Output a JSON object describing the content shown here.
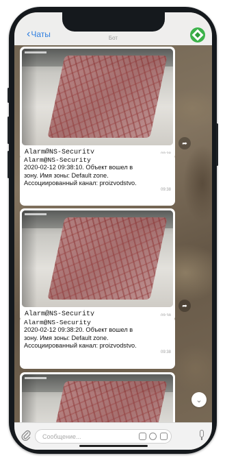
{
  "header": {
    "back_label": "Чаты",
    "chat_title": "Бот"
  },
  "messages": [
    {
      "type": "photo",
      "caption": "Alarm@NS-Security",
      "time": "09:38"
    },
    {
      "type": "text",
      "sender": "Alarm@NS-Security",
      "line1": "2020-02-12 09:38:10. Объект вошел в",
      "line2": "зону. Имя зоны: Default zone.",
      "line3": "Ассоциированный канал: proizvodstvo.",
      "time": "09:38"
    },
    {
      "type": "photo",
      "caption": "Alarm@NS-Security",
      "time": "09:38"
    },
    {
      "type": "text",
      "sender": "Alarm@NS-Security",
      "line1": "2020-02-12 09:38:20. Объект вошел в",
      "line2": "зону. Имя зоны: Default zone.",
      "line3": "Ассоциированный канал: proizvodstvo.",
      "time": "09:38"
    }
  ],
  "composer": {
    "placeholder": "Сообщение..."
  },
  "icons": {
    "back": "chevron-left-icon",
    "avatar": "bot-avatar-icon",
    "share": "share-arrow-icon",
    "scroll": "chevron-down-icon",
    "attach": "paperclip-icon",
    "commands": "slash-command-icon",
    "timer": "clock-icon",
    "stickers": "sticker-icon",
    "mic": "microphone-icon"
  },
  "colors": {
    "accent": "#2f7fe0",
    "avatar_bg": "#3cb24a",
    "bubble": "#ffffff"
  }
}
